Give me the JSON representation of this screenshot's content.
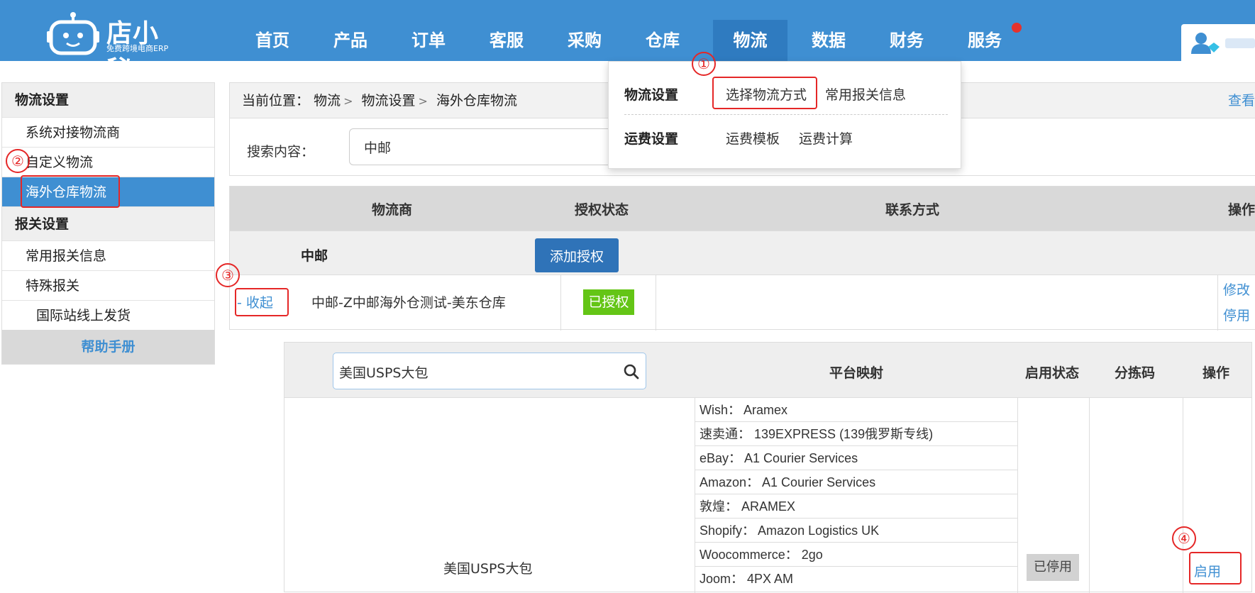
{
  "topbar": {
    "brand": "店小秘",
    "tagline": "免费跨境电商ERP",
    "nav": [
      "首页",
      "产品",
      "订单",
      "客服",
      "采购",
      "仓库",
      "物流",
      "数据",
      "财务",
      "服务"
    ],
    "active": "物流",
    "accent": "#3f8fd2"
  },
  "dropdown": {
    "group1_title": "物流设置",
    "group1_links": [
      "选择物流方式",
      "常用报关信息"
    ],
    "group2_title": "运费设置",
    "group2_links": [
      "运费模板",
      "运费计算"
    ]
  },
  "sidebar": {
    "section1": "物流设置",
    "items1": [
      "系统对接物流商",
      "自定义物流",
      "海外仓库物流"
    ],
    "section2": "报关设置",
    "items2": [
      "常用报关信息",
      "特殊报关",
      "国际站线上发货"
    ],
    "help": "帮助手册"
  },
  "breadcrumb": {
    "prefix": "当前位置：",
    "path": [
      "物流",
      "物流设置",
      "海外仓库物流"
    ],
    "more": "查看"
  },
  "search": {
    "label": "搜索内容：",
    "value": "中邮"
  },
  "main_table": {
    "headers": [
      "物流商",
      "授权状态",
      "联系方式",
      "操作"
    ],
    "carrier": "中邮",
    "add_auth": "添加授权",
    "row": {
      "toggle": "- 收起",
      "name": "中邮-Z中邮海外仓测试-美东仓库",
      "status": "已授权",
      "actions": [
        "修改",
        "停用"
      ]
    }
  },
  "sub_table": {
    "search_value": "美国USPS大包",
    "headers": [
      "平台映射",
      "启用状态",
      "分拣码",
      "操作"
    ],
    "row_name": "美国USPS大包",
    "mappings": [
      "Wish： Aramex",
      "速卖通： 139EXPRESS (139俄罗斯专线)",
      "eBay： A1 Courier Services",
      "Amazon： A1 Courier Services",
      "敦煌： ARAMEX",
      "Shopify： Amazon Logistics UK",
      "Woocommerce： 2go",
      "Joom： 4PX AM"
    ],
    "status": "已停用",
    "action": "启用"
  },
  "annotations": [
    "①",
    "②",
    "③",
    "④"
  ]
}
